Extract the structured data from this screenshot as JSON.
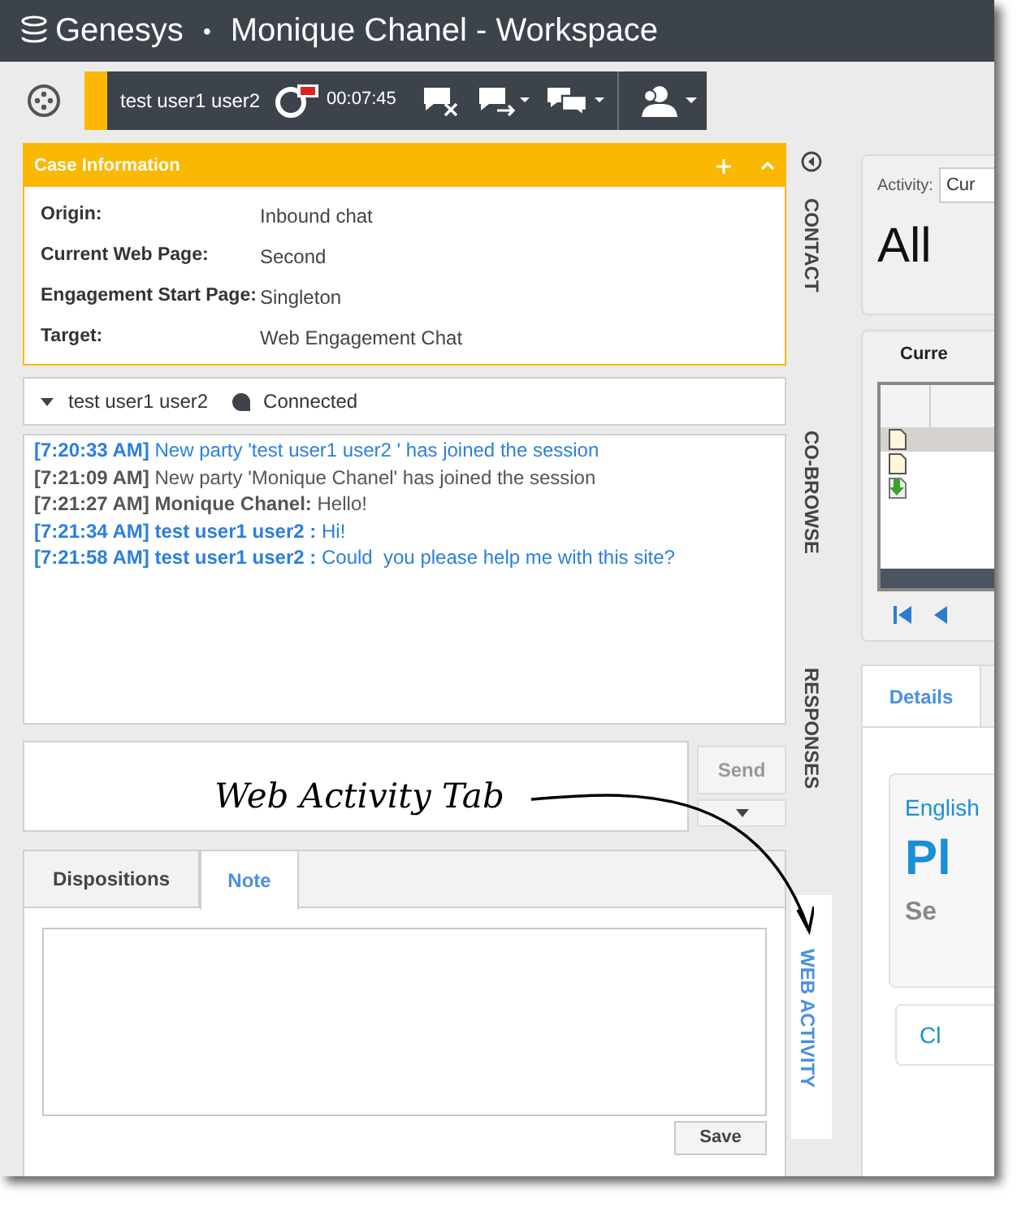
{
  "window": {
    "brand": "Genesys",
    "separator": "•",
    "title": "Monique Chanel - Workspace"
  },
  "interaction_bar": {
    "party": "test user1 user2",
    "timer": "00:07:45"
  },
  "case_information": {
    "title": "Case Information",
    "fields": [
      {
        "label": "Origin:",
        "value": "Inbound chat"
      },
      {
        "label": "Current Web Page:",
        "value": "Second"
      },
      {
        "label": "Engagement Start Page:",
        "value": "Singleton"
      },
      {
        "label": "Target:",
        "value": "Web Engagement Chat"
      }
    ]
  },
  "party_row": {
    "name": "test user1 user2",
    "status": "Connected"
  },
  "transcript": [
    {
      "kind": "customer",
      "time": "[7:20:33 AM]",
      "text": "New party 'test user1 user2 ' has joined the session"
    },
    {
      "kind": "agent",
      "time": "[7:21:09 AM]",
      "text": "New party 'Monique Chanel' has joined the session"
    },
    {
      "kind": "agent",
      "time": "[7:21:27 AM]",
      "sender": "Monique Chanel:",
      "text": "Hello!"
    },
    {
      "kind": "customer",
      "time": "[7:21:34 AM]",
      "sender": "test user1 user2 :",
      "text": "Hi!"
    },
    {
      "kind": "customer",
      "time": "[7:21:58 AM]",
      "sender": "test user1 user2 :",
      "text": "Could  you please help me with this site?"
    }
  ],
  "composer": {
    "send": "Send"
  },
  "note_tabs": [
    {
      "label": "Dispositions",
      "selected": false
    },
    {
      "label": "Note",
      "selected": true
    }
  ],
  "note": {
    "save": "Save"
  },
  "side_tabs": [
    {
      "label": "CONTACT",
      "selected": false
    },
    {
      "label": "CO-BROWSE",
      "selected": false
    },
    {
      "label": "RESPONSES",
      "selected": false
    },
    {
      "label": "WEB ACTIVITY",
      "selected": true
    }
  ],
  "activity": {
    "label": "Activity:",
    "value": "Cur",
    "heading": "All"
  },
  "current": {
    "title": "Curre",
    "rows": [
      {
        "kind": "document",
        "selected": true
      },
      {
        "kind": "document",
        "selected": false
      },
      {
        "kind": "download",
        "selected": false
      }
    ]
  },
  "details": {
    "tab": "Details",
    "language": "English",
    "heading": "Pl",
    "subheading": "Se",
    "button": "Cl"
  },
  "annotation": {
    "text": "Web Activity Tab"
  }
}
